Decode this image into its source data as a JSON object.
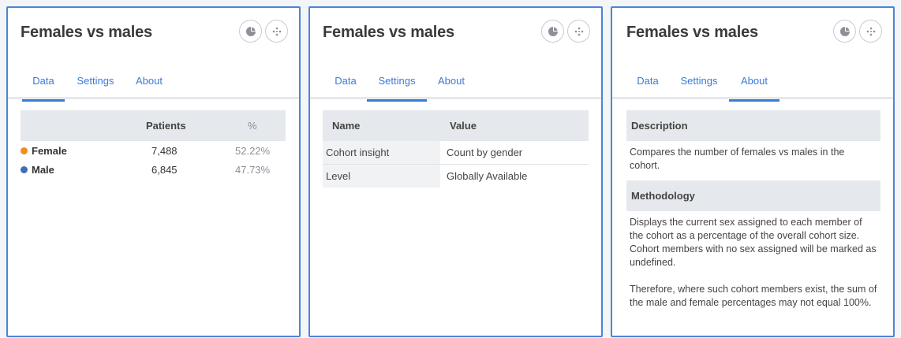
{
  "cards": [
    {
      "title": "Females vs males",
      "tabs": [
        "Data",
        "Settings",
        "About"
      ],
      "active_tab": "Data"
    },
    {
      "title": "Females vs males",
      "tabs": [
        "Data",
        "Settings",
        "About"
      ],
      "active_tab": "Settings"
    },
    {
      "title": "Females vs males",
      "tabs": [
        "Data",
        "Settings",
        "About"
      ],
      "active_tab": "About"
    }
  ],
  "icons": {
    "chart_button": "pie-chart-icon",
    "scatter_button": "scatter-icon"
  },
  "data_table": {
    "headers": {
      "label": "",
      "patients": "Patients",
      "percent": "%"
    },
    "rows": [
      {
        "label": "Female",
        "patients": "7,488",
        "percent": "52.22%",
        "color": "#f28c1e"
      },
      {
        "label": "Male",
        "patients": "6,845",
        "percent": "47.73%",
        "color": "#3f6fb5"
      }
    ]
  },
  "settings_table": {
    "headers": {
      "name": "Name",
      "value": "Value"
    },
    "rows": [
      {
        "name": "Cohort insight",
        "value": "Count by gender"
      },
      {
        "name": "Level",
        "value": "Globally Available"
      }
    ]
  },
  "about": {
    "description_heading": "Description",
    "description_text": "Compares the number of females vs males in the cohort.",
    "methodology_heading": "Methodology",
    "methodology_text_1": "Displays the current sex assigned to each member of the cohort as a percentage of the overall cohort size. Cohort members with no sex assigned will be marked as undefined.",
    "methodology_text_2": "Therefore, where such cohort members exist, the sum of the male and female percentages may not equal 100%."
  },
  "colors": {
    "accent": "#3a7bd5",
    "card_border": "#4a86d6",
    "female": "#f28c1e",
    "male": "#3f6fb5",
    "header_bg": "#e5e8ec"
  }
}
